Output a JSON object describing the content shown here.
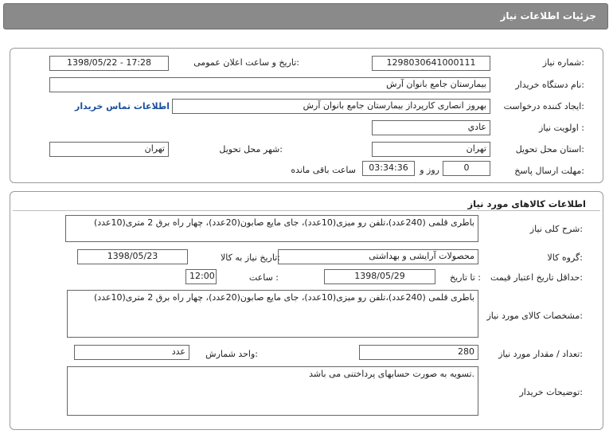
{
  "header": {
    "title": "جزئیات اطلاعات نیاز"
  },
  "info": {
    "need_number_label": "شماره نیاز:",
    "need_number": "1298030641000111",
    "announce_label": "تاریخ و ساعت اعلان عمومی:",
    "announce_value": "1398/05/22 - 17:28",
    "buyer_label": "نام دستگاه خریدار:",
    "buyer_value": "بیمارستان جامع بانوان آرش",
    "creator_label": "ایجاد کننده درخواست:",
    "creator_value": "بهروز انصاری کارپرداز بیمارستان جامع بانوان آرش",
    "contact_link": "اطلاعات تماس خریدار",
    "priority_label": "اولویت نیاز :",
    "priority_value": "عادي",
    "province_label": "استان محل تحویل:",
    "province_value": "تهران",
    "city_label": "شهر محل تحویل:",
    "city_value": "تهران",
    "deadline_label": "مهلت ارسال پاسخ:",
    "deadline_days": "0",
    "day_and": "روز و",
    "deadline_time": "03:34:36",
    "remaining": "ساعت باقی مانده"
  },
  "goods": {
    "section_title": "اطلاعات کالاهای مورد نیاز",
    "desc_label": "شرح کلی نیاز:",
    "desc_value": "باطری قلمی (240عدد)،تلفن رو میزی(10عدد)، جای مایع صابون(20عدد)، چهار راه برق 2 متری(10عدد)",
    "group_label": "گروه کالا:",
    "group_value": "محصولات آرایشی و بهداشتی",
    "need_date_label": "تاریخ نیاز به کالا:",
    "need_date_value": "1398/05/23",
    "min_price_label": "حداقل تاریخ اعتبار قیمت:",
    "until_date_label": "تا تاریخ :",
    "until_date_value": "1398/05/29",
    "hour_label": "ساعت :",
    "hour_value": "12:00",
    "spec_label": "مشخصات کالای مورد نیاز:",
    "spec_value": "باطری قلمی (240عدد)،تلفن رو میزی(10عدد)، جای مایع صابون(20عدد)، چهار راه برق 2 متری(10عدد)",
    "qty_label": "تعداد / مقدار مورد نیاز:",
    "qty_value": "280",
    "unit_label": "واحد شمارش:",
    "unit_value": "عدد",
    "notes_label": "توضیحات خریدار:",
    "notes_value": "تسویه به صورت حسابهای پرداختنی می باشد."
  }
}
